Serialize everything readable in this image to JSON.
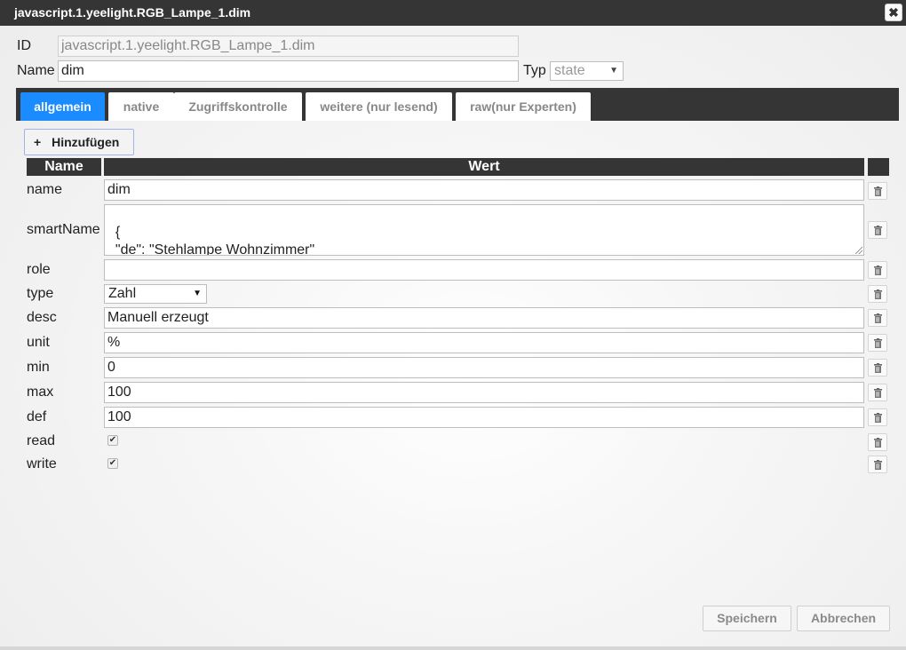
{
  "window": {
    "title": "javascript.1.yeelight.RGB_Lampe_1.dim",
    "close_icon": "close-icon"
  },
  "header": {
    "id_label": "ID",
    "id_value": "javascript.1.yeelight.RGB_Lampe_1.dim",
    "name_label": "Name",
    "name_value": "dim",
    "typ_label": "Typ",
    "typ_value": "state"
  },
  "tabs": [
    {
      "label": "allgemein",
      "active": true
    },
    {
      "label": "native",
      "active": false
    },
    {
      "label": "Zugriffskontrolle",
      "active": false
    },
    {
      "label": "weitere (nur lesend)",
      "active": false
    },
    {
      "label": "raw(nur Experten)",
      "active": false
    }
  ],
  "toolbar": {
    "add_icon": "+",
    "add_label": "Hinzufügen"
  },
  "table": {
    "col_name": "Name",
    "col_value": "Wert",
    "rows": [
      {
        "key": "name",
        "value": "dim"
      },
      {
        "key": "smartName",
        "value": "{\n  \"de\": \"Stehlampe Wohnzimmer\"\n}"
      },
      {
        "key": "role",
        "value": ""
      },
      {
        "key": "type",
        "value": "Zahl"
      },
      {
        "key": "desc",
        "value": "Manuell erzeugt"
      },
      {
        "key": "unit",
        "value": "%"
      },
      {
        "key": "min",
        "value": "0"
      },
      {
        "key": "max",
        "value": "100"
      },
      {
        "key": "def",
        "value": "100"
      },
      {
        "key": "read",
        "checked": true
      },
      {
        "key": "write",
        "checked": true
      }
    ]
  },
  "footer": {
    "save_label": "Speichern",
    "cancel_label": "Abbrechen"
  },
  "colors": {
    "titlebar": "#353535",
    "tab_active": "#1a8cff"
  }
}
